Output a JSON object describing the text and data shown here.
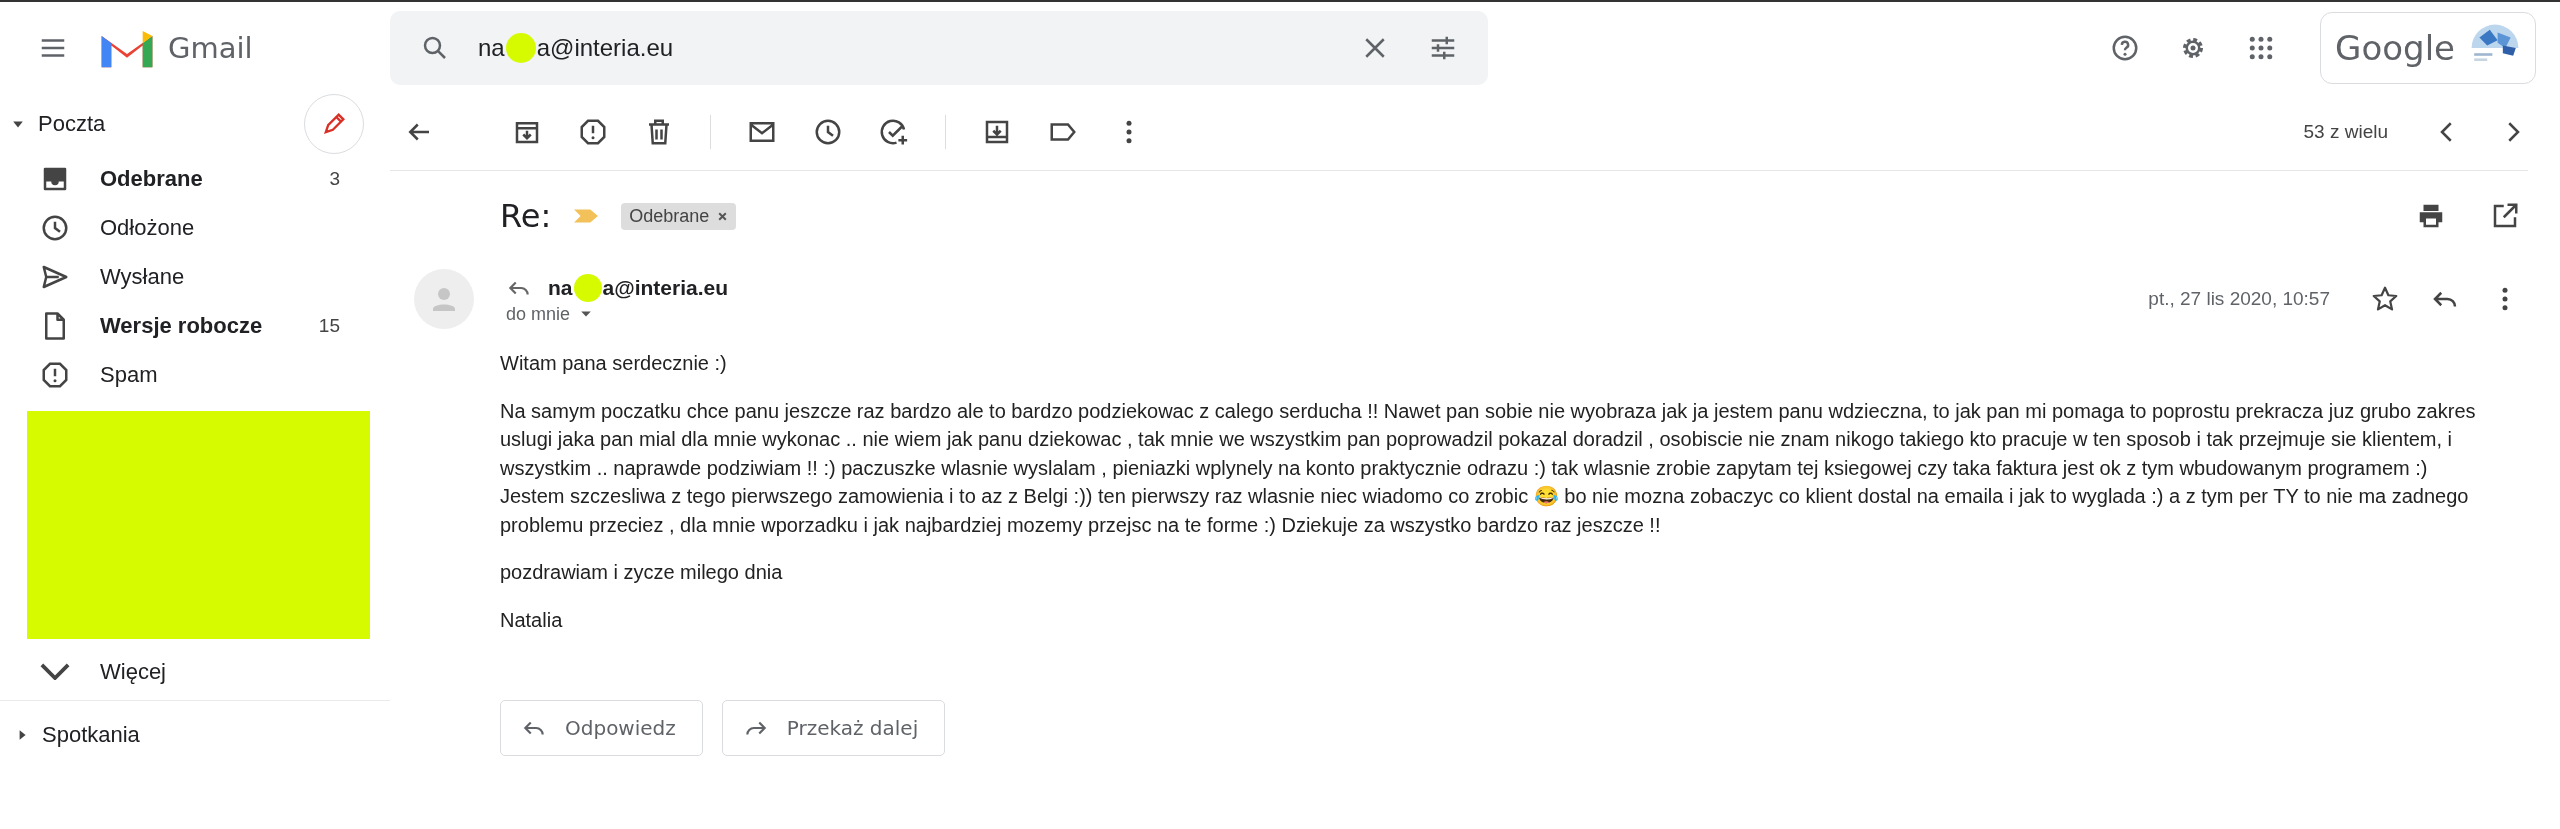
{
  "header": {
    "app_name": "Gmail",
    "search": {
      "value_parts": [
        "na",
        "a@interia.eu"
      ]
    },
    "account": {
      "brand": "Google"
    }
  },
  "sidebar": {
    "section": "Poczta",
    "items": [
      {
        "kind": "inbox",
        "label": "Odebrane",
        "count": "3",
        "unread": true
      },
      {
        "kind": "snoozed",
        "label": "Odłożone",
        "unread": false
      },
      {
        "kind": "sent",
        "label": "Wysłane",
        "unread": false
      },
      {
        "kind": "drafts",
        "label": "Wersje robocze",
        "count": "15",
        "unread": true
      },
      {
        "kind": "spam",
        "label": "Spam",
        "unread": false
      }
    ],
    "more": "Więcej",
    "meetings": "Spotkania"
  },
  "toolbar": {
    "position": "53 z wielu"
  },
  "message": {
    "subject": "Re:",
    "label": "Odebrane",
    "sender_parts": [
      "na",
      "a@interia.eu"
    ],
    "recipient": "do mnie",
    "date": "pt., 27 lis 2020, 10:57",
    "starred": false,
    "body": [
      "Witam pana serdecznie :)",
      "Na samym poczatku chce panu jeszcze raz bardzo ale to bardzo podziekowac z calego serducha !! Nawet pan sobie nie wyobraza jak ja jestem panu wdzieczna, to jak pan mi pomaga to poprostu prekracza juz grubo zakres uslugi jaka pan mial dla mnie wykonac .. nie wiem jak panu dziekowac , tak mnie we wszystkim pan poprowadzil pokazal doradzil , osobiscie nie znam nikogo takiego kto pracuje w ten sposob i tak przejmuje sie klientem, i wszystkim .. naprawde podziwiam !! :) paczuszke wlasnie wyslalam , pieniazki wplynely na konto praktycznie odrazu :) tak wlasnie zrobie zapytam tej ksiegowej czy taka faktura jest ok z tym wbudowanym programem :) Jestem szczesliwa z tego pierwszego zamowienia i to az z Belgi :)) ten pierwszy raz wlasnie niec wiadomo co zrobic 😂 bo nie mozna zobaczyc co klient dostal na emaila i jak to wyglada :) a z tym per TY to nie ma zadnego problemu przeciez , dla mnie wporzadku i jak najbardziej mozemy przejsc na te forme :) Dziekuje za wszystko bardzo raz jeszcze !!",
      "pozdrawiam i zycze milego dnia",
      "Natalia"
    ],
    "actions": [
      {
        "kind": "reply",
        "label": "Odpowiedz"
      },
      {
        "kind": "forward",
        "label": "Przekaż dalej"
      }
    ]
  }
}
